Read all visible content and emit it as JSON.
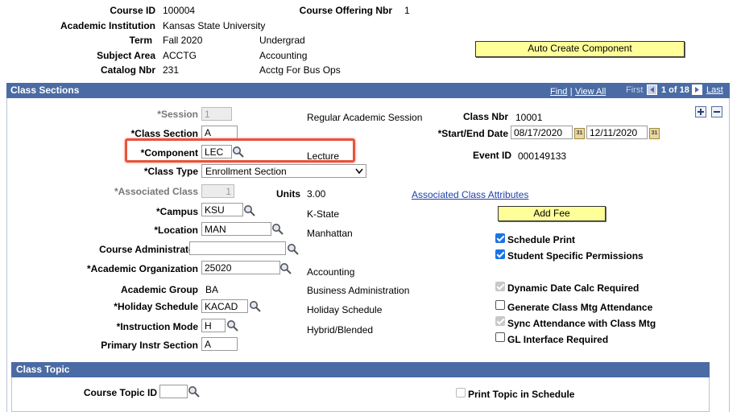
{
  "header": {
    "course_id_label": "Course ID",
    "course_id": "100004",
    "course_offering_label": "Course Offering Nbr",
    "course_offering": "1",
    "institution_label": "Academic Institution",
    "institution": "Kansas State University",
    "term_label": "Term",
    "term": "Fall 2020",
    "term_career": "Undergrad",
    "subject_label": "Subject Area",
    "subject": "ACCTG",
    "subject_desc": "Accounting",
    "catalog_label": "Catalog Nbr",
    "catalog": "231",
    "catalog_desc": "Acctg For Bus Ops",
    "auto_create_button": "Auto Create Component"
  },
  "class_sections": {
    "title": "Class Sections",
    "nav": {
      "find": "Find",
      "separator": "|",
      "view_all": "View All",
      "first": "First",
      "counter": "1 of 18",
      "last": "Last"
    },
    "session_label": "*Session",
    "session_value": "1",
    "session_desc": "Regular Academic Session",
    "class_section_label": "*Class Section",
    "class_section_value": "A",
    "component_label": "*Component",
    "component_value": "LEC",
    "component_desc": "Lecture",
    "class_type_label": "*Class Type",
    "class_type_value": "Enrollment Section",
    "associated_class_label": "*Associated Class",
    "associated_class_value": "1",
    "units_label": "Units",
    "units_value": "3.00",
    "campus_label": "*Campus",
    "campus_value": "KSU",
    "campus_desc": "K-State",
    "location_label": "*Location",
    "location_value": "MAN",
    "location_desc": "Manhattan",
    "course_admin_label": "Course Administrator",
    "course_admin_value": "",
    "acad_org_label": "*Academic Organization",
    "acad_org_value": "25020",
    "acad_org_desc": "Accounting",
    "acad_group_label": "Academic Group",
    "acad_group_value": "BA",
    "acad_group_desc": "Business Administration",
    "holiday_label": "*Holiday Schedule",
    "holiday_value": "KACAD",
    "holiday_desc": "Holiday Schedule",
    "instr_mode_label": "*Instruction Mode",
    "instr_mode_value": "H",
    "instr_mode_desc": "Hybrid/Blended",
    "primary_instr_label": "Primary Instr Section",
    "primary_instr_value": "A",
    "class_nbr_label": "Class Nbr",
    "class_nbr_value": "10001",
    "start_end_label": "*Start/End Date",
    "start_date": "08/17/2020",
    "end_date": "12/11/2020",
    "event_id_label": "Event ID",
    "event_id_value": "000149133",
    "assoc_attr_link": "Associated Class Attributes",
    "add_fee_button": "Add Fee",
    "checkboxes": {
      "schedule_print": "Schedule Print",
      "student_permissions": "Student Specific Permissions",
      "dynamic_date": "Dynamic Date Calc Required",
      "generate_attendance": "Generate Class Mtg Attendance",
      "sync_attendance": "Sync Attendance with Class Mtg",
      "gl_interface": "GL Interface Required"
    },
    "highlight_color": "#e8533b",
    "header_color": "#4b6ba4"
  },
  "class_topic": {
    "title": "Class Topic",
    "course_topic_label": "Course Topic ID",
    "course_topic_value": "",
    "print_topic_label": "Print Topic in Schedule"
  }
}
